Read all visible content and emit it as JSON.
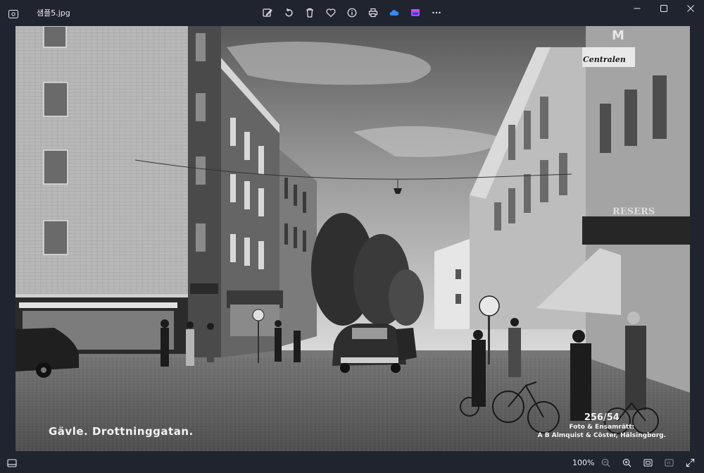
{
  "window": {
    "file_name": "샘플5.jpg"
  },
  "toolbar": {
    "icons": [
      "edit-icon",
      "rotate-icon",
      "delete-icon",
      "favorite-icon",
      "info-icon",
      "print-icon",
      "onedrive-icon",
      "clipchamp-icon",
      "more-icon"
    ]
  },
  "photo": {
    "caption_left": "Gävle. Drottninggatan.",
    "caption_number": "256/54",
    "caption_line1": "Foto & Ensamrätt:",
    "caption_line2": "A B Almquist & Cöster, Hälsingborg.",
    "signs": {
      "store_top": "Centralen",
      "store_top_letter": "M",
      "kiosk": "RESERS"
    }
  },
  "statusbar": {
    "zoom": "100%"
  },
  "colors": {
    "chrome": "#20242f",
    "onedrive": "#2e8cff",
    "clipchamp": "#8b5cf6"
  }
}
